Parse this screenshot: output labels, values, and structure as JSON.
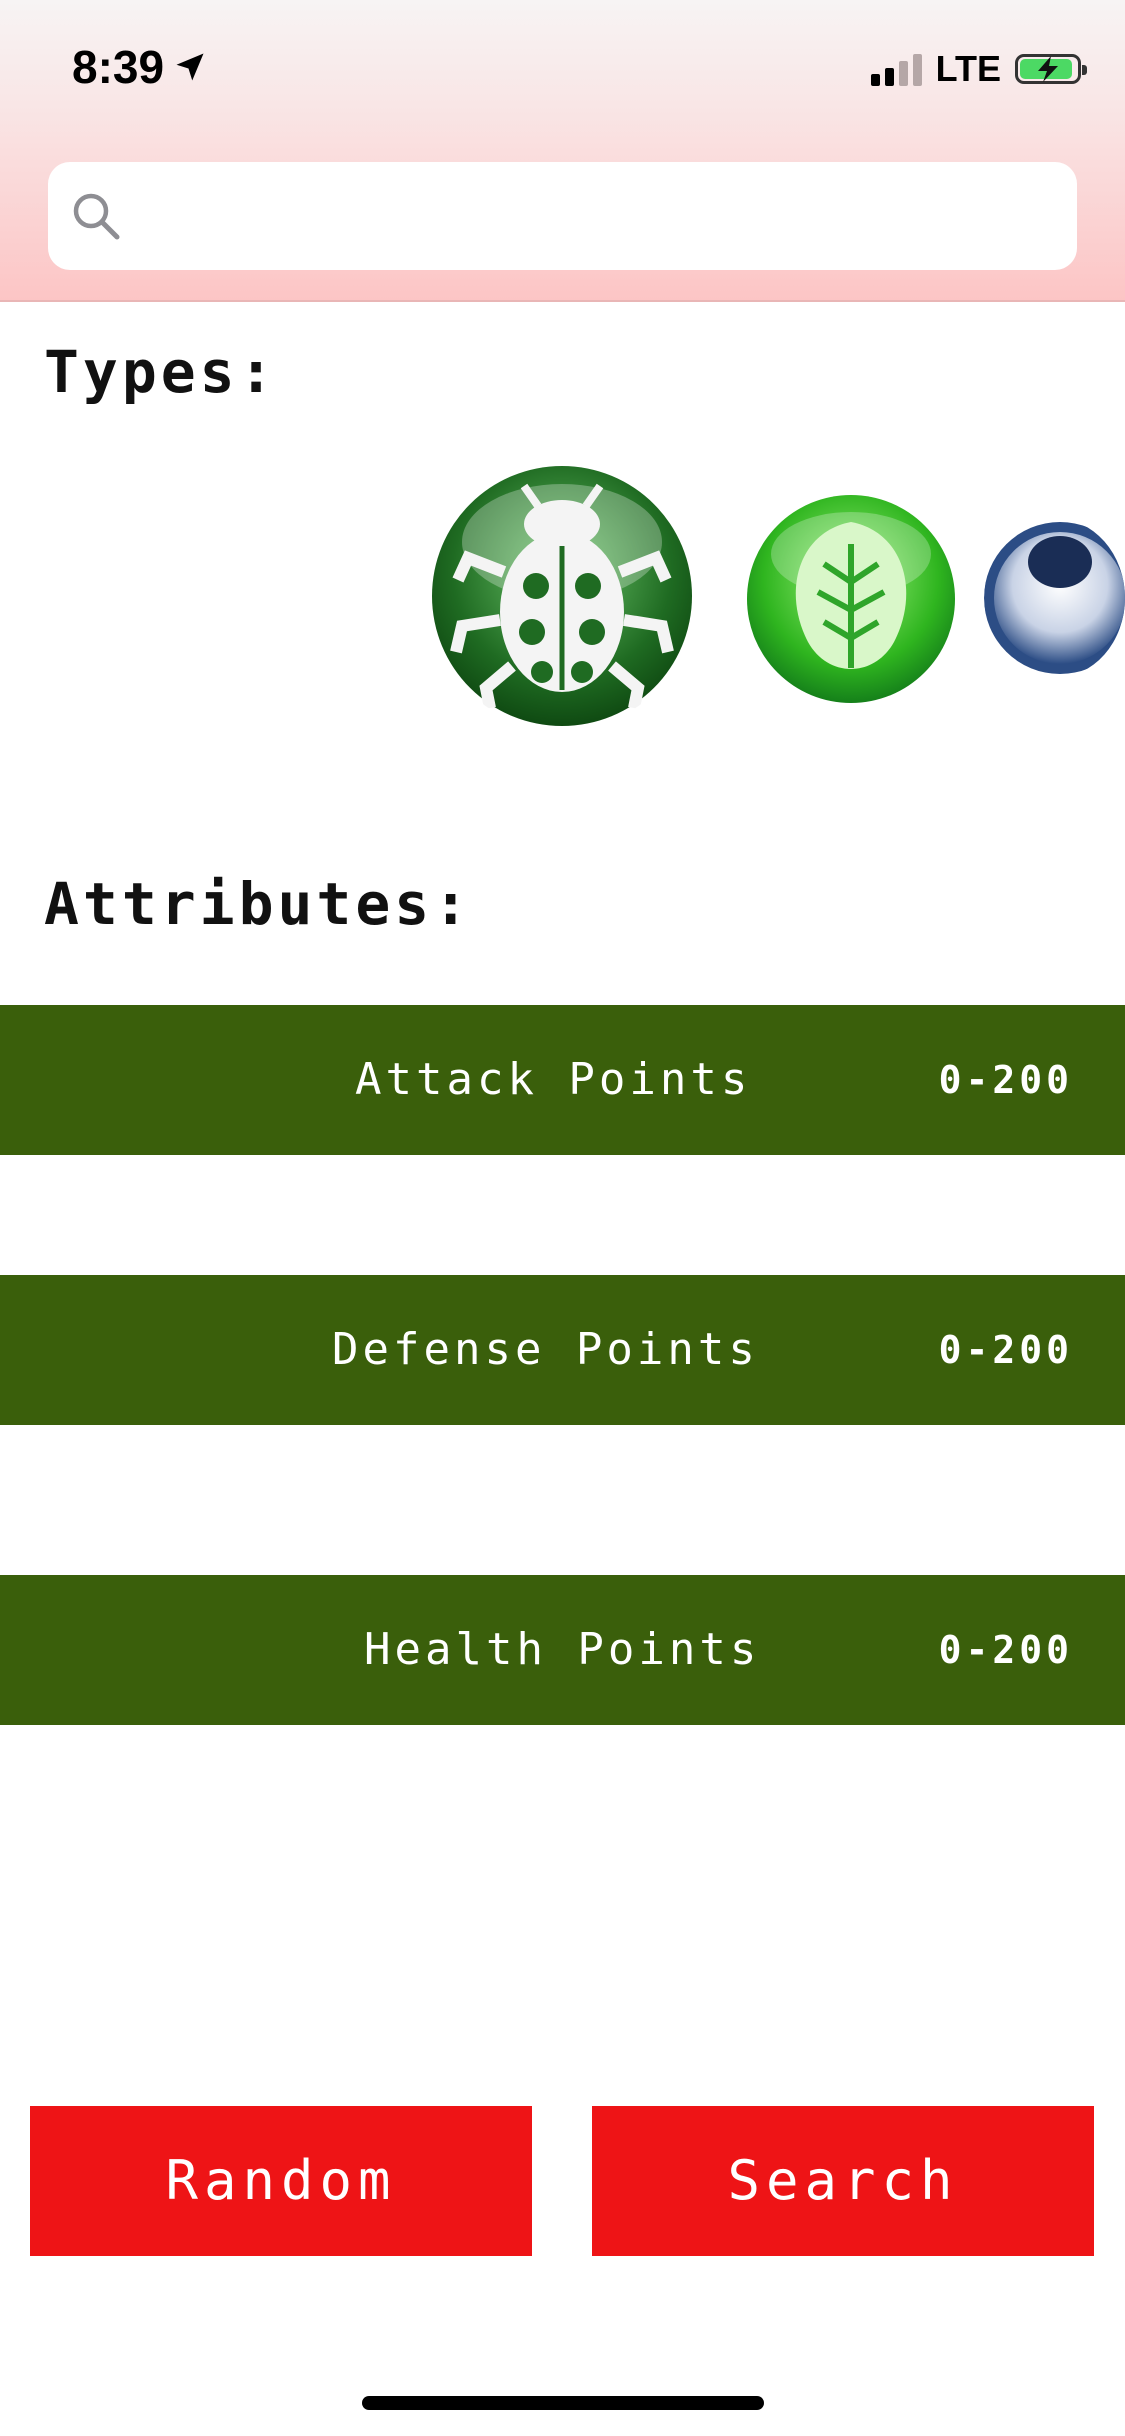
{
  "status_bar": {
    "time": "8:39",
    "network": "LTE",
    "location_icon": "location-arrow-icon",
    "battery_color": "#4cd964"
  },
  "search": {
    "placeholder": "",
    "value": "",
    "icon": "search-icon"
  },
  "types_section": {
    "title": "Types:",
    "items": [
      {
        "name": "bug",
        "icon": "bug-type-icon",
        "color": "#2e8b2e"
      },
      {
        "name": "grass",
        "icon": "grass-type-icon",
        "color": "#35c52a"
      },
      {
        "name": "eye",
        "icon": "eye-type-icon",
        "color": "#2c4d85"
      }
    ]
  },
  "attributes_section": {
    "title": "Attributes:",
    "items": [
      {
        "label": "Attack Points",
        "range": "0-200"
      },
      {
        "label": "Defense Points",
        "range": "0-200"
      },
      {
        "label": "Health Points",
        "range": "0-200"
      }
    ],
    "bar_color": "#3a5f0b"
  },
  "actions": {
    "random_label": "Random",
    "search_label": "Search",
    "button_color": "#ee1416"
  }
}
